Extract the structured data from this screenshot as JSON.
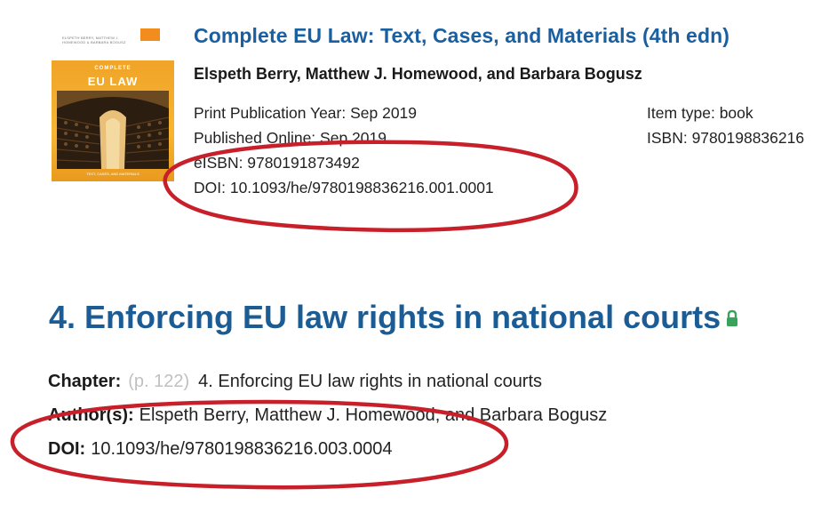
{
  "book": {
    "cover": {
      "authors_small": "ELSPETH BERRY, MATTHEW J. HOMEWOOD & BARBARA BOGUSZ",
      "series_label": "COMPLETE",
      "title": "EU LAW",
      "footer": "TEXT, CASES, AND MATERIALS",
      "accent_color": "#f28c1f"
    },
    "title": "Complete EU Law: Text, Cases, and Materials (4th edn)",
    "authors": "Elspeth Berry, Matthew J. Homewood, and Barbara Bogusz",
    "meta_left": [
      "Print Publication Year: Sep 2019",
      "Published Online: Sep 2019",
      "eISBN: 9780191873492",
      "DOI: 10.1093/he/9780198836216.001.0001"
    ],
    "meta_right": [
      "Item type: book",
      "ISBN: 9780198836216"
    ]
  },
  "chapter": {
    "heading": "4. Enforcing EU law rights in national courts",
    "lock_icon": "lock-icon",
    "chapter_label": "Chapter:",
    "page_ref": "(p. 122)",
    "chapter_title": "4. Enforcing EU law rights in national courts",
    "authors_label": "Author(s):",
    "authors": "Elspeth Berry, Matthew J. Homewood, and Barbara Bogusz",
    "doi_label": "DOI:",
    "doi": "10.1093/he/9780198836216.003.0004"
  },
  "annotation_color": "#c8202a",
  "link_color": "#1a5fa0",
  "lock_color": "#3aa35a"
}
